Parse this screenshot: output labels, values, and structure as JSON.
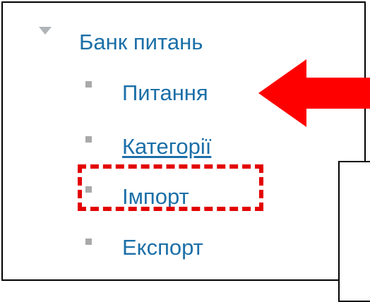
{
  "menu": {
    "section_label": "Банк питань",
    "items": [
      {
        "label": "Питання"
      },
      {
        "label": "Категорії"
      },
      {
        "label": "Імпорт"
      },
      {
        "label": "Експорт"
      }
    ]
  },
  "colors": {
    "link": "#1b6fa8",
    "bullet": "#a9a9a9",
    "highlight": "#e30000",
    "toggle": "#aeb4b8"
  }
}
